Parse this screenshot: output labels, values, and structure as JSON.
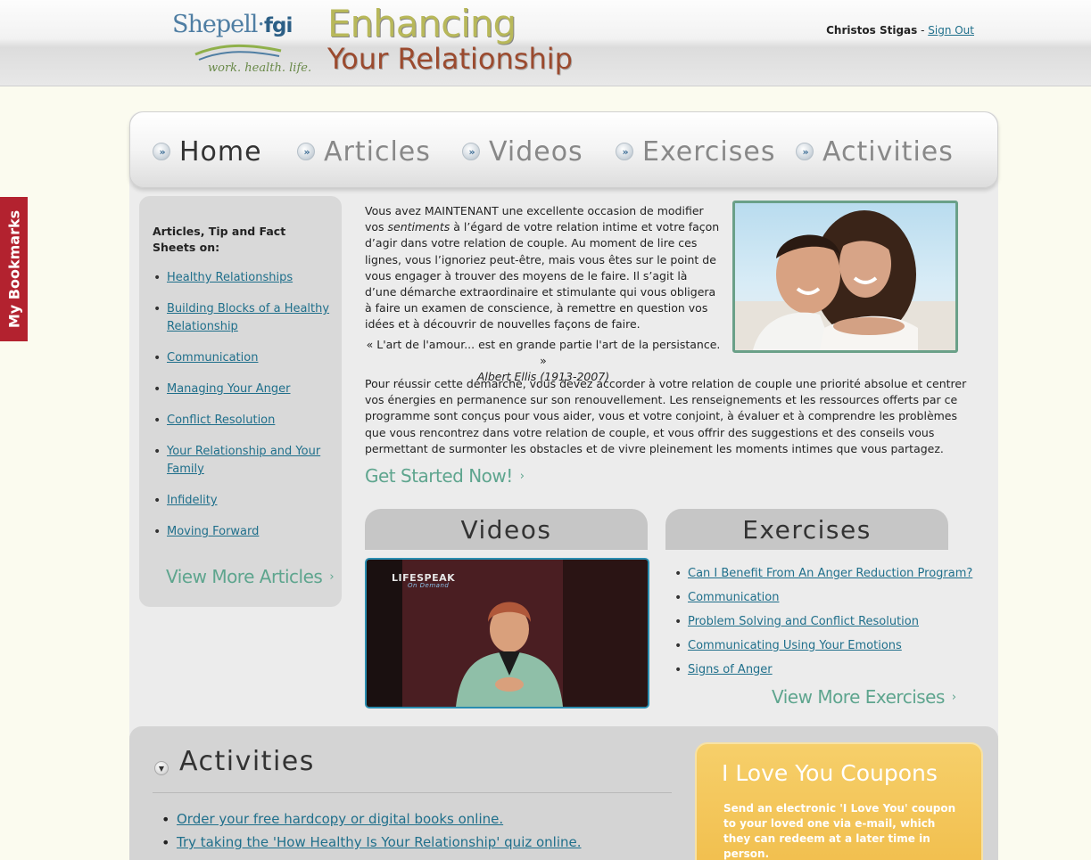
{
  "header": {
    "logo_main": "Shepell",
    "logo_dot": "·",
    "logo_bold": "fgi",
    "logo_tagline": "work. health. life.",
    "program_line1": "Enhancing",
    "program_line2": "Your Relationship",
    "user_name": "Christos Stigas",
    "user_separator": " - ",
    "sign_out": "Sign Out"
  },
  "bookmarks_tab": "My Bookmarks",
  "nav": {
    "items": [
      {
        "label": "Home",
        "active": true
      },
      {
        "label": "Articles",
        "active": false
      },
      {
        "label": "Videos",
        "active": false
      },
      {
        "label": "Exercises",
        "active": false
      },
      {
        "label": "Activities",
        "active": false
      }
    ],
    "bullet_glyph": "»"
  },
  "sidebar": {
    "title": "Articles, Tip and Fact Sheets on:",
    "items": [
      "Healthy Relationships",
      "Building Blocks of a Healthy Relationship",
      "Communication",
      "Managing Your Anger",
      "Conflict Resolution",
      "Your Relationship and Your Family",
      "Infidelity",
      "Moving Forward"
    ],
    "view_more": "View More Articles"
  },
  "intro": {
    "p1_before": "Vous avez MAINTENANT une excellente occasion de modifier vos ",
    "p1_italic": "sentiments",
    "p1_after": " à l’égard de votre relation intime et votre façon d’agir dans votre relation de couple. Au moment de lire ces lignes, vous l’ignoriez peut-être, mais vous êtes sur le point de vous engager à trouver des moyens de le faire. Il s’agit là d’une démarche extraordinaire et stimulante qui vous obligera à faire un examen de conscience, à remettre en question vos idées et à découvrir de nouvelles façons de faire.",
    "quote": "« L'art de l'amour... est en grande partie l'art de la persistance. »",
    "quote_author": "Albert Ellis (1913-2007)",
    "p2": "Pour réussir cette démarche, vous devez accorder à votre relation de couple une priorité absolue et centrer vos énergies en permanence sur son renouvellement. Les renseignements et les ressources offerts par ce programme sont conçus pour vous aider, vous et votre conjoint, à évaluer et à comprendre les problèmes que vous rencontrez dans votre relation de couple, et vous offrir des suggestions et des conseils vous permettant de surmonter les obstacles et de vivre pleinement les moments intimes que vous partagez.",
    "get_started": "Get Started Now!"
  },
  "videos": {
    "heading": "Videos",
    "thumb_logo": "LIFESPEAK",
    "thumb_logo_sub": "On Demand"
  },
  "exercises": {
    "heading": "Exercises",
    "items": [
      "Can I Benefit From An Anger Reduction Program?",
      "Communication",
      "Problem Solving and Conflict Resolution",
      "Communicating Using Your Emotions",
      "Signs of Anger"
    ],
    "view_more": "View More Exercises"
  },
  "activities": {
    "heading": "Activities",
    "items": [
      "Order your free hardcopy or digital books online.",
      "Try taking the 'How Healthy Is Your Relationship' quiz online."
    ]
  },
  "coupon": {
    "title": "I Love You Coupons",
    "text": "Send an electronic 'I Love You' coupon to your loved one via e-mail, which they can redeem at a later time in person."
  },
  "chevron_glyph": "›",
  "colors": {
    "accent_green": "#5ea58e",
    "link_blue": "#1f6f8b",
    "bookmark_red": "#b3222f",
    "coupon_gold": "#f1be4c"
  }
}
